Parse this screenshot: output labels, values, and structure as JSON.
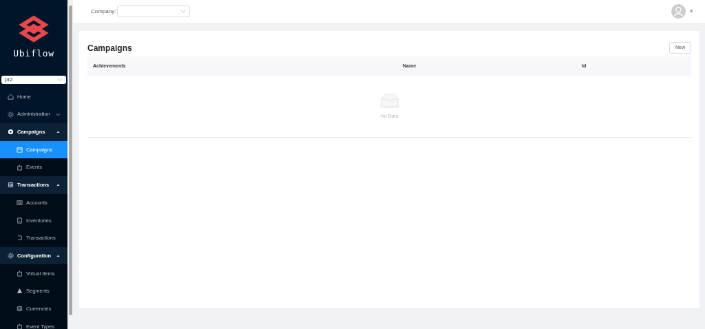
{
  "sidebar": {
    "logo_text": "Ubiflow",
    "project_select": {
      "value": "pr2"
    },
    "menu": [
      {
        "kind": "item",
        "label": "Home",
        "selected": false
      },
      {
        "kind": "group",
        "label": "Administration",
        "expanded": false
      },
      {
        "kind": "group",
        "label": "Campaigns",
        "expanded": true,
        "children": [
          {
            "label": "Campaigns",
            "selected": true
          },
          {
            "label": "Events",
            "selected": false
          }
        ]
      },
      {
        "kind": "group",
        "label": "Transactions",
        "expanded": true,
        "children": [
          {
            "label": "Accounts",
            "selected": false
          },
          {
            "label": "Inventories",
            "selected": false
          },
          {
            "label": "Transactions",
            "selected": false
          }
        ]
      },
      {
        "kind": "group",
        "label": "Configuration",
        "expanded": true,
        "children": [
          {
            "label": "Virtual Items",
            "selected": false
          },
          {
            "label": "Segments",
            "selected": false
          },
          {
            "label": "Currencies",
            "selected": false
          },
          {
            "label": "Event Types",
            "selected": false
          }
        ]
      }
    ]
  },
  "header": {
    "company_label": "Company:",
    "user_name": "a"
  },
  "card": {
    "title": "Campaigns",
    "new_button": "New",
    "table": {
      "columns": [
        "Achievements",
        "Name",
        "Id"
      ],
      "empty_text": "No Data"
    }
  }
}
